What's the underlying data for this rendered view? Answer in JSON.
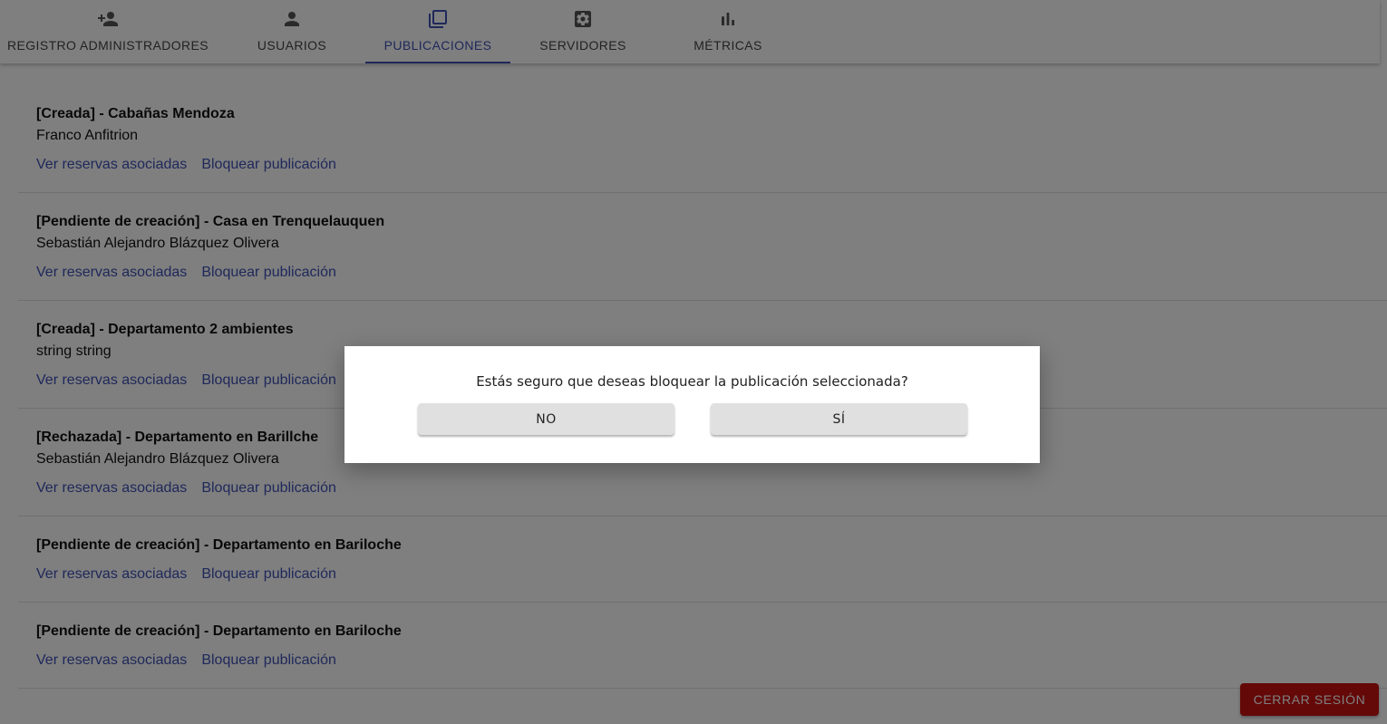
{
  "tabs": [
    {
      "label": "REGISTRO ADMINISTRADORES",
      "icon": "person-add-icon"
    },
    {
      "label": "USUARIOS",
      "icon": "person-icon"
    },
    {
      "label": "PUBLICACIONES",
      "icon": "library-icon",
      "active": true
    },
    {
      "label": "SERVIDORES",
      "icon": "settings-icon"
    },
    {
      "label": "MÉTRICAS",
      "icon": "bar-chart-icon"
    }
  ],
  "colors": {
    "accent": "#3f51b5",
    "danger": "#c81010"
  },
  "publications": [
    {
      "title": "[Creada] - Cabañas Mendoza",
      "host": "Franco Anfitrion"
    },
    {
      "title": "[Pendiente de creación] - Casa en Trenquelauquen",
      "host": "Sebastián Alejandro Blázquez Olivera"
    },
    {
      "title": "[Creada] - Departamento 2 ambientes",
      "host": "string string"
    },
    {
      "title": "[Rechazada] - Departamento en Barillche",
      "host": "Sebastián Alejandro Blázquez Olivera"
    },
    {
      "title": "[Pendiente de creación] - Departamento en Bariloche",
      "host": ""
    },
    {
      "title": "[Pendiente de creación] - Departamento en Bariloche",
      "host": ""
    }
  ],
  "actions": {
    "view_reservations": "Ver reservas asociadas",
    "block_publication": "Bloquear publicación"
  },
  "logout_label": "CERRAR SESIÓN",
  "dialog": {
    "message": "Estás seguro que deseas bloquear la publicación seleccionada?",
    "no_label": "NO",
    "yes_label": "SÍ"
  }
}
